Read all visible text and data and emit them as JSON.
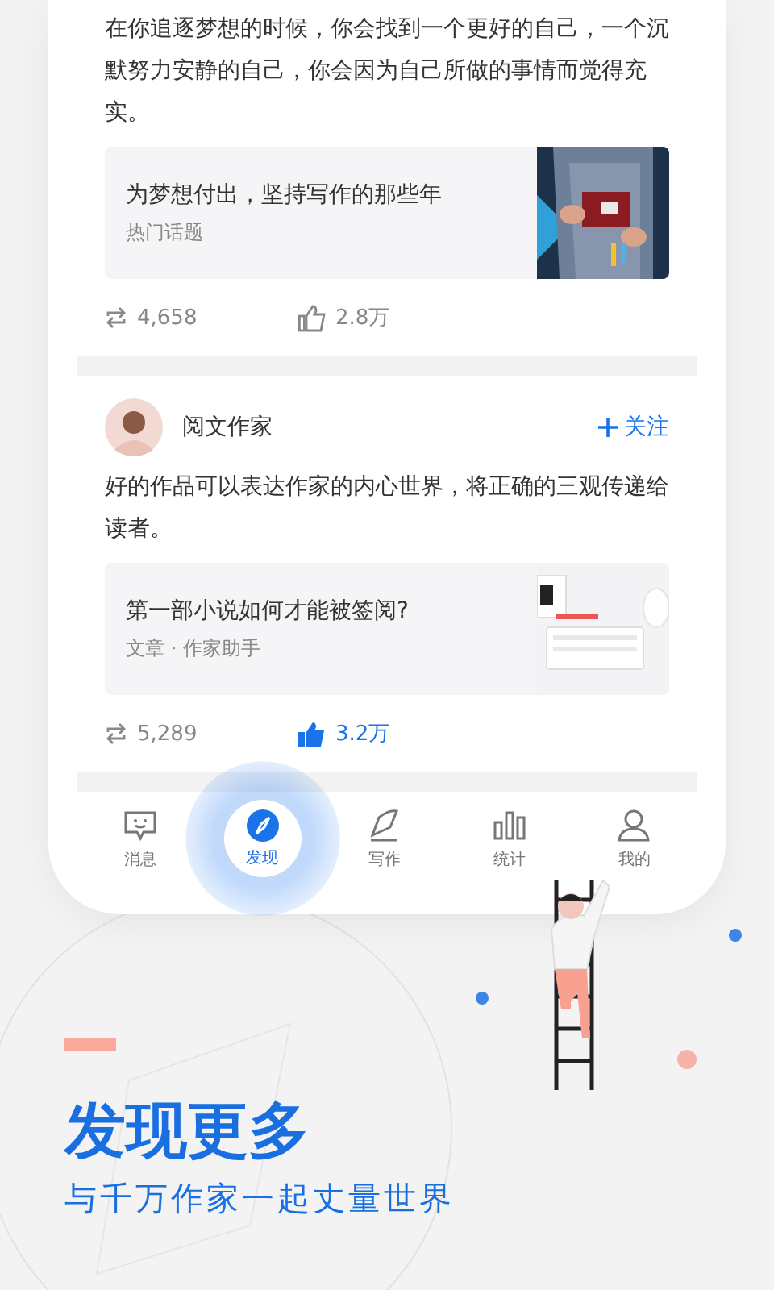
{
  "posts": [
    {
      "text": "在你追逐梦想的时候，你会找到一个更好的自己，一个沉默努力安静的自己，你会因为自己所做的事情而觉得充实。",
      "link": {
        "title": "为梦想付出，坚持写作的那些年",
        "meta": "热门话题",
        "kind": "picture"
      },
      "reposts": "4,658",
      "likes": "2.8万",
      "liked": false
    },
    {
      "author": {
        "name": "阅文作家",
        "follow": "关注"
      },
      "text": "好的作品可以表达作家的内心世界，将正确的三观传递给读者。",
      "link": {
        "title": "第一部小说如何才能被签阅?",
        "meta": "文章 · 作家助手",
        "kind": "picture"
      },
      "reposts": "5,289",
      "likes": "3.2万",
      "liked": true
    }
  ],
  "tabs": [
    {
      "label": "消息",
      "selected": false
    },
    {
      "label": "发现",
      "selected": true
    },
    {
      "label": "写作",
      "selected": false
    },
    {
      "label": "统计",
      "selected": false
    },
    {
      "label": "我的",
      "selected": false
    }
  ],
  "headline": "发现更多",
  "tagline": "与千万作家一起丈量世界"
}
